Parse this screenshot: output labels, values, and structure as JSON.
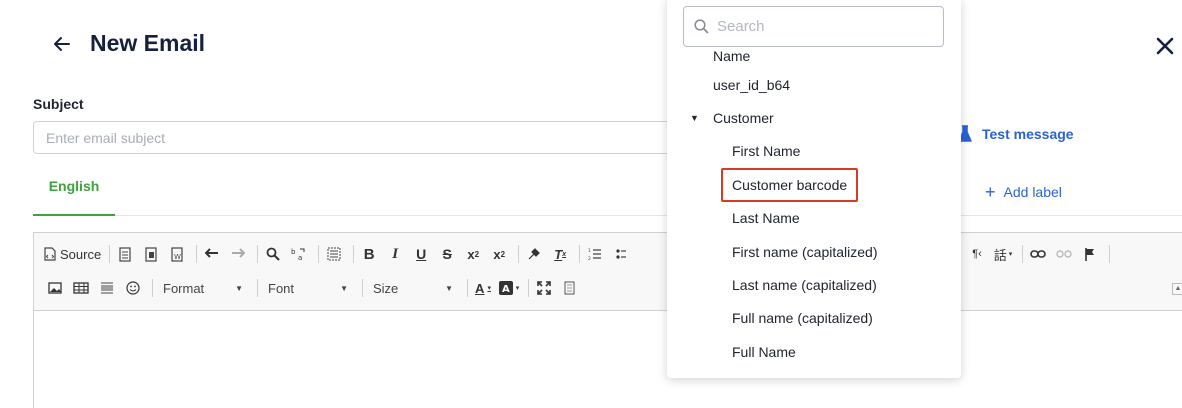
{
  "header": {
    "title": "New Email"
  },
  "subject": {
    "label": "Subject",
    "placeholder": "Enter email subject"
  },
  "actions": {
    "test_message": "Test message",
    "add_label": "Add label"
  },
  "tabs": [
    {
      "label": "English",
      "active": true
    }
  ],
  "toolbar": {
    "source_label": "Source",
    "format_label": "Format",
    "font_label": "Font",
    "size_label": "Size"
  },
  "dropdown": {
    "search_placeholder": "Search",
    "items": [
      {
        "label": "Name",
        "level": 0
      },
      {
        "label": "user_id_b64",
        "level": 0
      },
      {
        "label": "Customer",
        "level": 0,
        "expanded": true
      },
      {
        "label": "First Name",
        "level": 1
      },
      {
        "label": "Customer barcode",
        "level": 1,
        "highlighted": true
      },
      {
        "label": "Last Name",
        "level": 1
      },
      {
        "label": "First name (capitalized)",
        "level": 1
      },
      {
        "label": "Last name (capitalized)",
        "level": 1
      },
      {
        "label": "Full name (capitalized)",
        "level": 1
      },
      {
        "label": "Full Name",
        "level": 1
      }
    ]
  },
  "colors": {
    "accent_green": "#3ea23e",
    "link_blue": "#2a63d6",
    "highlight_red": "#d63c22",
    "title": "#15213d"
  }
}
